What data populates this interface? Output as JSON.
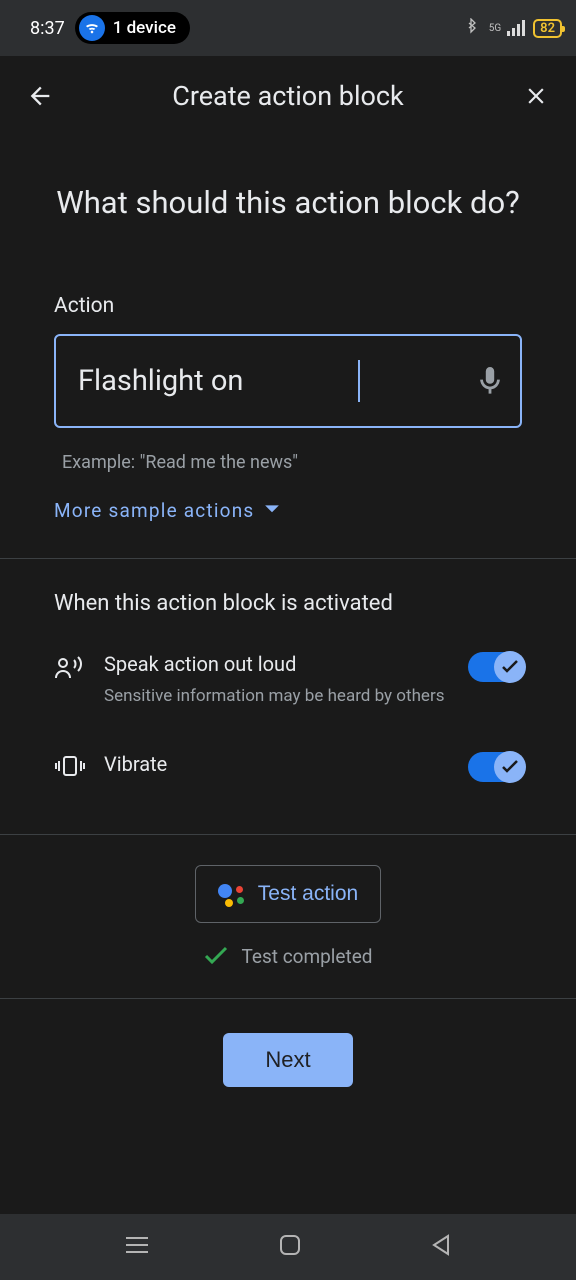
{
  "status_bar": {
    "time": "8:37",
    "device_label": "1 device",
    "battery": "82",
    "signal_label": "5G"
  },
  "header": {
    "title": "Create action block"
  },
  "question": "What should this action block do?",
  "action": {
    "label": "Action",
    "value": "Flashlight on",
    "example": "Example: \"Read me the news\"",
    "sample_link": "More sample actions"
  },
  "activation": {
    "title": "When this action block is activated",
    "speak": {
      "label": "Speak action out loud",
      "sublabel": "Sensitive information may be heard by others",
      "enabled": true
    },
    "vibrate": {
      "label": "Vibrate",
      "enabled": true
    }
  },
  "test": {
    "button": "Test action",
    "status": "Test completed"
  },
  "next_button": "Next"
}
